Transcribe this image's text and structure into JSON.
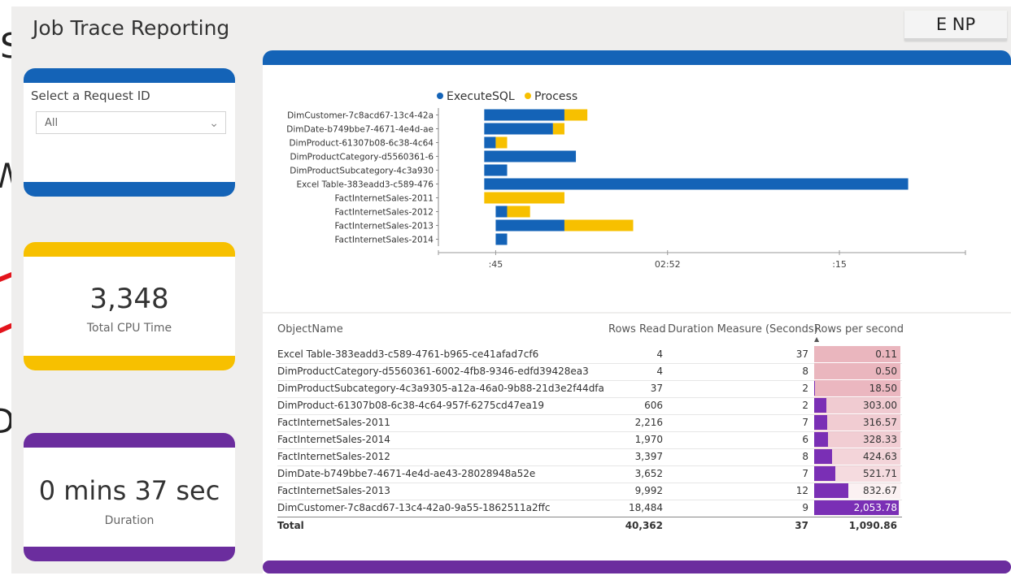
{
  "app": {
    "title": "Job Trace Reporting",
    "button_label": "E NP"
  },
  "background_letters": [
    "S",
    "W",
    "D"
  ],
  "filter_card": {
    "label": "Select a Request ID",
    "selected": "All",
    "chevron_icon": "chevron-down-icon",
    "band_color": "#1463b7"
  },
  "cpu_card": {
    "value": "3,348",
    "label": "Total CPU Time",
    "band_color": "#f7c000"
  },
  "duration_card": {
    "value": "0 mins 37 sec",
    "label": "Duration",
    "band_color": "#6b2d9e"
  },
  "chart_data": {
    "type": "bar",
    "orientation": "horizontal",
    "stacked": true,
    "legend_position": "top",
    "categories": [
      "DimCustomer-7c8acd67-13c4-42a",
      "DimDate-b749bbe7-4671-4e4d-ae",
      "DimProduct-61307b08-6c38-4c64",
      "DimProductCategory-d5560361-6",
      "DimProductSubcategory-4c3a930",
      "Excel Table-383eadd3-c589-476",
      "FactInternetSales-2011",
      "FactInternetSales-2012",
      "FactInternetSales-2013",
      "FactInternetSales-2014"
    ],
    "series": [
      {
        "name": "ExecuteSQL",
        "color": "#1463b7",
        "start": [
          0.4,
          0.4,
          0.4,
          0.4,
          0.4,
          0.4,
          null,
          0.5,
          0.5,
          0.5
        ],
        "length": [
          0.7,
          0.6,
          0.1,
          0.8,
          0.2,
          3.7,
          null,
          0.1,
          0.6,
          0.1
        ]
      },
      {
        "name": "Process",
        "color": "#f7c000",
        "start": [
          1.1,
          1.0,
          0.5,
          null,
          null,
          null,
          0.4,
          0.6,
          1.1,
          null
        ],
        "length": [
          0.2,
          0.1,
          0.1,
          null,
          null,
          null,
          0.7,
          0.2,
          0.6,
          null
        ]
      }
    ],
    "x_range": [
      0,
      4.6
    ],
    "x_ticks": [
      {
        "label": ":45",
        "value": 0.5
      },
      {
        "label": "02:52",
        "value": 2.0
      },
      {
        "label": ":15",
        "value": 3.5
      }
    ],
    "grid": false
  },
  "table": {
    "headers": [
      "ObjectName",
      "Rows Read",
      "Duration Measure (Seconds)",
      "Rows per second"
    ],
    "sort_icon": "sort-ascending-icon",
    "rows": [
      {
        "name": "Excel Table-383eadd3-c589-4761-b965-ce41afad7cf6",
        "rows_read": "4",
        "duration": "37",
        "rps": "0.11",
        "rps_value": 0.11
      },
      {
        "name": "DimProductCategory-d5560361-6002-4fb8-9346-edfd39428ea3",
        "rows_read": "4",
        "duration": "8",
        "rps": "0.50",
        "rps_value": 0.5
      },
      {
        "name": "DimProductSubcategory-4c3a9305-a12a-46a0-9b88-21d3e2f44dfa",
        "rows_read": "37",
        "duration": "2",
        "rps": "18.50",
        "rps_value": 18.5
      },
      {
        "name": "DimProduct-61307b08-6c38-4c64-957f-6275cd47ea19",
        "rows_read": "606",
        "duration": "2",
        "rps": "303.00",
        "rps_value": 303.0
      },
      {
        "name": "FactInternetSales-2011",
        "rows_read": "2,216",
        "duration": "7",
        "rps": "316.57",
        "rps_value": 316.57
      },
      {
        "name": "FactInternetSales-2014",
        "rows_read": "1,970",
        "duration": "6",
        "rps": "328.33",
        "rps_value": 328.33
      },
      {
        "name": "FactInternetSales-2012",
        "rows_read": "3,397",
        "duration": "8",
        "rps": "424.63",
        "rps_value": 424.63
      },
      {
        "name": "DimDate-b749bbe7-4671-4e4d-ae43-28028948a52e",
        "rows_read": "3,652",
        "duration": "7",
        "rps": "521.71",
        "rps_value": 521.71
      },
      {
        "name": "FactInternetSales-2013",
        "rows_read": "9,992",
        "duration": "12",
        "rps": "832.67",
        "rps_value": 832.67
      },
      {
        "name": "DimCustomer-7c8acd67-13c4-42a0-9a55-1862511a2ffc",
        "rows_read": "18,484",
        "duration": "9",
        "rps": "2,053.78",
        "rps_value": 2053.78
      }
    ],
    "total": {
      "name": "Total",
      "rows_read": "40,362",
      "duration": "37",
      "rps": "1,090.86"
    },
    "rps_bar_color": "#7a2fb5",
    "rps_bg_color": "#e9b2bb"
  }
}
